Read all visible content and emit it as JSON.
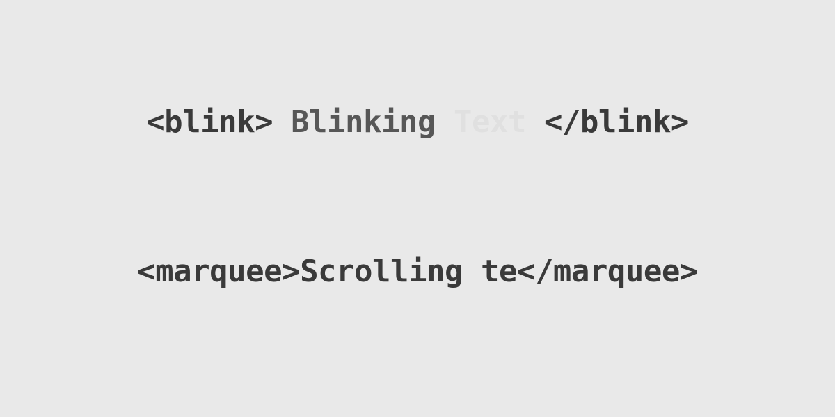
{
  "line1": {
    "open_tag": "<blink>",
    "word1": "Blinking",
    "word2": "Text",
    "close_tag": "</blink>"
  },
  "line2": {
    "open_tag": "<marquee>",
    "content": "Scrolling te",
    "close_tag": "</marquee>"
  }
}
